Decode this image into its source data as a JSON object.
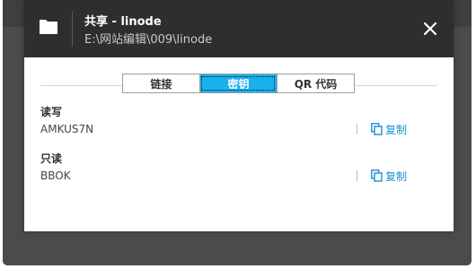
{
  "dialog": {
    "title": "共享 - linode",
    "path": "E:\\网站编辑\\009\\linode",
    "icons": {
      "folder": "folder-icon",
      "close": "close-icon",
      "copy": "copy-icon"
    }
  },
  "tabs": [
    {
      "label": "链接",
      "active": false
    },
    {
      "label": "密钥",
      "active": true
    },
    {
      "label": "QR 代码",
      "active": false
    }
  ],
  "read_write": {
    "label": "读写",
    "value": "AMKUS7N",
    "copy_label": "复制"
  },
  "read_only": {
    "label": "只读",
    "value": "BBOK",
    "copy_label": "复制"
  },
  "colors": {
    "header_bg": "#2e2e2e",
    "accent": "#1ab0ee",
    "link": "#1a8fd6"
  }
}
